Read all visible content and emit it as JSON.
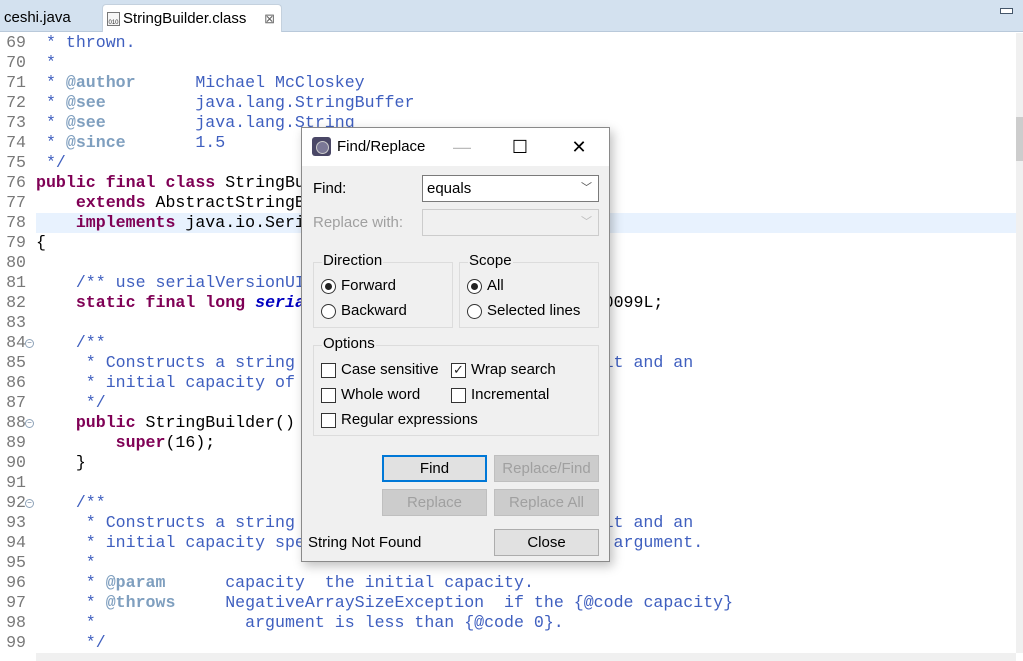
{
  "tabs": [
    {
      "label": "ceshi.java",
      "active": false
    },
    {
      "label": "StringBuilder.class",
      "active": true,
      "icon": "class-file-icon",
      "close": "⊠"
    }
  ],
  "editor": {
    "current_line": 78,
    "lines": [
      {
        "n": "69",
        "s": [
          [
            "d",
            " * thrown."
          ]
        ]
      },
      {
        "n": "70",
        "s": [
          [
            "d",
            " *"
          ]
        ]
      },
      {
        "n": "71",
        "s": [
          [
            "d",
            " * "
          ],
          [
            "t",
            "@author"
          ],
          [
            "d",
            "      Michael McCloskey"
          ]
        ]
      },
      {
        "n": "72",
        "s": [
          [
            "d",
            " * "
          ],
          [
            "t",
            "@see"
          ],
          [
            "d",
            "         java.lang.StringBuffer"
          ]
        ]
      },
      {
        "n": "73",
        "s": [
          [
            "d",
            " * "
          ],
          [
            "t",
            "@see"
          ],
          [
            "d",
            "         java.lang.String"
          ]
        ]
      },
      {
        "n": "74",
        "s": [
          [
            "d",
            " * "
          ],
          [
            "t",
            "@since"
          ],
          [
            "d",
            "       1.5"
          ]
        ]
      },
      {
        "n": "75",
        "s": [
          [
            "d",
            " */"
          ]
        ]
      },
      {
        "n": "76",
        "s": [
          [
            "k",
            "public final class"
          ],
          [
            "n",
            " StringBu"
          ]
        ]
      },
      {
        "n": "77",
        "s": [
          [
            "n",
            "    "
          ],
          [
            "k",
            "extends"
          ],
          [
            "n",
            " AbstractStringB"
          ]
        ]
      },
      {
        "n": "78",
        "s": [
          [
            "n",
            "    "
          ],
          [
            "k",
            "implements"
          ],
          [
            "n",
            " java.io.Seri"
          ]
        ]
      },
      {
        "n": "79",
        "s": [
          [
            "n",
            "{"
          ]
        ]
      },
      {
        "n": "80",
        "s": []
      },
      {
        "n": "81",
        "s": [
          [
            "d",
            "    /** use serialVersionUI"
          ]
        ]
      },
      {
        "n": "82",
        "s": [
          [
            "n",
            "    "
          ],
          [
            "k",
            "static final long"
          ],
          [
            "n",
            " "
          ],
          [
            "f",
            "seria"
          ],
          [
            "n",
            "                              0099L;"
          ]
        ]
      },
      {
        "n": "83",
        "s": []
      },
      {
        "n": "84",
        "fold": true,
        "s": [
          [
            "d",
            "    /**"
          ]
        ]
      },
      {
        "n": "85",
        "s": [
          [
            "d",
            "     * Constructs a string                               it and an"
          ]
        ]
      },
      {
        "n": "86",
        "s": [
          [
            "d",
            "     * initial capacity of"
          ]
        ]
      },
      {
        "n": "87",
        "s": [
          [
            "d",
            "     */"
          ]
        ]
      },
      {
        "n": "88",
        "fold": true,
        "s": [
          [
            "n",
            "    "
          ],
          [
            "k",
            "public"
          ],
          [
            "n",
            " StringBuilder()"
          ]
        ]
      },
      {
        "n": "89",
        "s": [
          [
            "n",
            "        "
          ],
          [
            "k",
            "super"
          ],
          [
            "n",
            "(16);"
          ]
        ]
      },
      {
        "n": "90",
        "s": [
          [
            "n",
            "    }"
          ]
        ]
      },
      {
        "n": "91",
        "s": []
      },
      {
        "n": "92",
        "fold": true,
        "s": [
          [
            "d",
            "    /**"
          ]
        ]
      },
      {
        "n": "93",
        "s": [
          [
            "d",
            "     * Constructs a string                               it and an"
          ]
        ]
      },
      {
        "n": "94",
        "s": [
          [
            "d",
            "     * initial capacity spe                               argument."
          ]
        ]
      },
      {
        "n": "95",
        "s": [
          [
            "d",
            "     *"
          ]
        ]
      },
      {
        "n": "96",
        "s": [
          [
            "d",
            "     * "
          ],
          [
            "t",
            "@param"
          ],
          [
            "d",
            "      capacity  the initial capacity."
          ]
        ]
      },
      {
        "n": "97",
        "s": [
          [
            "d",
            "     * "
          ],
          [
            "t",
            "@throws"
          ],
          [
            "d",
            "     NegativeArraySizeException  if the {@code capacity}"
          ]
        ]
      },
      {
        "n": "98",
        "s": [
          [
            "d",
            "     *               argument is less than {@code 0}."
          ]
        ]
      },
      {
        "n": "99",
        "s": [
          [
            "d",
            "     */"
          ]
        ]
      }
    ]
  },
  "dialog": {
    "title": "Find/Replace",
    "icon": "eclipse-icon",
    "find_label": "Find:",
    "find_value": "equals",
    "replace_label": "Replace with:",
    "replace_value": "",
    "direction": {
      "label": "Direction",
      "forward": "Forward",
      "backward": "Backward",
      "selected": "Forward"
    },
    "scope": {
      "label": "Scope",
      "all": "All",
      "selected_lines": "Selected lines",
      "selected": "All"
    },
    "options": {
      "label": "Options",
      "case_sensitive": "Case sensitive",
      "wrap_search": "Wrap search",
      "whole_word": "Whole word",
      "incremental": "Incremental",
      "regex": "Regular expressions",
      "checked": {
        "case_sensitive": false,
        "wrap_search": true,
        "whole_word": false,
        "incremental": false,
        "regex": false
      }
    },
    "buttons": {
      "find": "Find",
      "replace_find": "Replace/Find",
      "replace": "Replace",
      "replace_all": "Replace All",
      "close": "Close"
    },
    "status": "String Not Found"
  },
  "colors": {
    "keyword": "#7f0055",
    "javadoc": "#3f5fbf",
    "javadoc_tag": "#7f9fbf",
    "field": "#0000c0",
    "focus": "#0078d7"
  }
}
